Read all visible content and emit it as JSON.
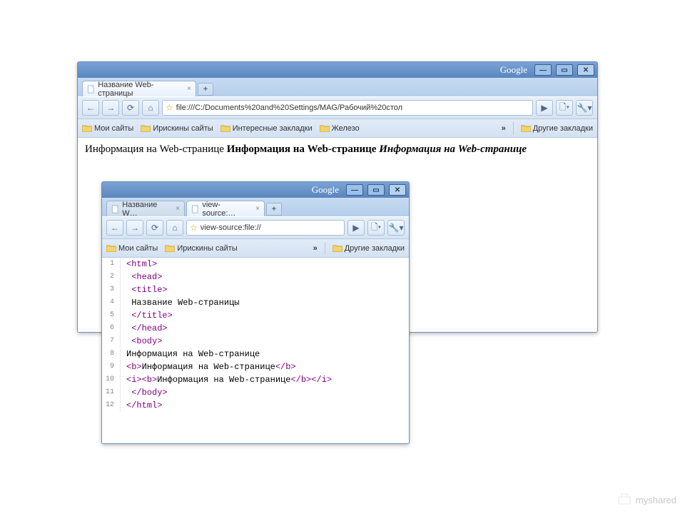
{
  "big": {
    "title_brand": "Google",
    "tab": {
      "label": "Название Web-страницы"
    },
    "url": "file:///C:/Documents%20and%20Settings/MAG/Рабочий%20стол",
    "bookmarks": [
      "Мои сайты",
      "Ирискины сайты",
      "Интересные закладки",
      "Железо"
    ],
    "bookmarks_overflow": "»",
    "other_bookmarks": "Другие закладки",
    "page_text_plain": "Информация на Web-странице ",
    "page_text_bold": "Информация на Web-странице ",
    "page_text_bolditalic": "Информация на Web-странице"
  },
  "small": {
    "title_brand": "Google",
    "tabs": [
      {
        "label": "Название W…"
      },
      {
        "label": "view-source:…"
      }
    ],
    "url": "view-source:file://",
    "bookmarks": [
      "Мои сайты",
      "Ирискины сайты"
    ],
    "bookmarks_overflow": "»",
    "other_bookmarks": "Другие закладки",
    "source": [
      {
        "n": "1",
        "html": "<span class='tag-purple'>&lt;html&gt;</span>"
      },
      {
        "n": "2",
        "html": " <span class='tag-purple'>&lt;head&gt;</span>"
      },
      {
        "n": "3",
        "html": " <span class='tag-purple'>&lt;title&gt;</span>"
      },
      {
        "n": "4",
        "html": " <span class='txt-black'>Название Web-страницы</span>"
      },
      {
        "n": "5",
        "html": " <span class='tag-purple'>&lt;/title&gt;</span>"
      },
      {
        "n": "6",
        "html": " <span class='tag-purple'>&lt;/head&gt;</span>"
      },
      {
        "n": "7",
        "html": " <span class='tag-purple'>&lt;body&gt;</span>"
      },
      {
        "n": "8",
        "html": "<span class='txt-black'>Информация на Web-странице</span>"
      },
      {
        "n": "9",
        "html": "<span class='tag-purple'>&lt;b&gt;</span><span class='txt-black'>Информация на Web-странице</span><span class='tag-purple'>&lt;/b&gt;</span>"
      },
      {
        "n": "10",
        "html": "<span class='tag-purple'>&lt;i&gt;&lt;b&gt;</span><span class='txt-black'>Информация на Web-странице</span><span class='tag-purple'>&lt;/b&gt;&lt;/i&gt;</span>"
      },
      {
        "n": "11",
        "html": " <span class='tag-purple'>&lt;/body&gt;</span>"
      },
      {
        "n": "12",
        "html": "<span class='tag-purple'>&lt;/html&gt;</span>"
      }
    ]
  },
  "watermark": "myshared"
}
